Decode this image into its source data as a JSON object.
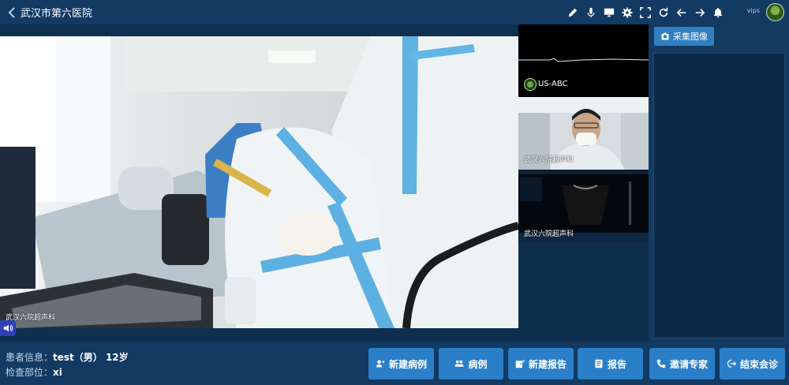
{
  "header": {
    "title": "武汉市第六医院",
    "username": "vips",
    "icons": [
      "back-icon",
      "pen-icon",
      "microphone-icon",
      "monitor-icon",
      "gear-icon",
      "fullscreen-icon",
      "refresh-icon",
      "arrow-left-icon",
      "arrow-right-icon",
      "bell-icon",
      "avatar"
    ]
  },
  "main_video": {
    "label": "武汉六院超声科"
  },
  "side_videos": [
    {
      "label": "US-ABC"
    },
    {
      "label": "武汉六院超声科"
    },
    {
      "label": "武汉六院超声科"
    }
  ],
  "right_panel": {
    "capture_label": "采集图像"
  },
  "patient": {
    "info_label": "患者信息：",
    "info_value": "test（男） 12岁",
    "part_label": "检查部位：",
    "part_value": "xi"
  },
  "actions": {
    "new_case": "新建病例",
    "cases": "病例",
    "new_report": "新建报告",
    "report": "报告",
    "invite_expert": "邀请专家",
    "end_meeting": "结束会诊"
  },
  "colors": {
    "bar_bg": "#123a63",
    "page_bg": "#0f2f4e",
    "button": "#2b7fc8"
  }
}
